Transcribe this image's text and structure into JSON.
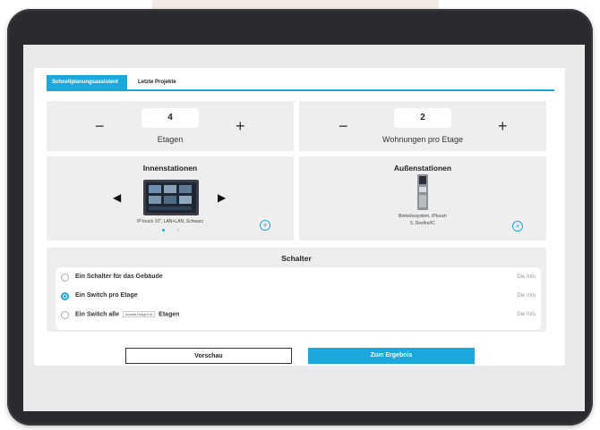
{
  "tabs": [
    {
      "label": "Schnellplanungsassistent",
      "active": true
    },
    {
      "label": "Letzte Projekte",
      "active": false
    }
  ],
  "floors": {
    "value": "4",
    "label": "Etagen",
    "minus": "−",
    "plus": "+"
  },
  "apartments": {
    "value": "2",
    "label": "Wohnungen pro Etage",
    "minus": "−",
    "plus": "+"
  },
  "indoor": {
    "title": "Innenstationen",
    "device_caption": "IP touch 10\", LAN+LAN, Schwarz",
    "prev": "◀",
    "next": "▶",
    "add": "+"
  },
  "outdoor": {
    "title": "Außenstationen",
    "device_caption_line1": "Betriebssystem, IPtouch",
    "device_caption_line2": "5, Desfire/IC",
    "add": "+"
  },
  "switches": {
    "title": "Schalter",
    "options": [
      {
        "label": "Ein Schalter für das Gebäude",
        "info": "Die Info",
        "checked": false
      },
      {
        "label": "Ein Switch pro Etage",
        "info": "Die Info",
        "checked": true
      },
      {
        "label_pre": "Ein Switch alle",
        "label_box": "Anzahl Etagen ei",
        "label_post": "Etagen",
        "info": "Die Info",
        "checked": false
      }
    ]
  },
  "buttons": {
    "preview": "Vorschau",
    "result": "Zum Ergebnis"
  },
  "colors": {
    "accent": "#1aa8dd",
    "tablet": "#2a2b2e"
  }
}
